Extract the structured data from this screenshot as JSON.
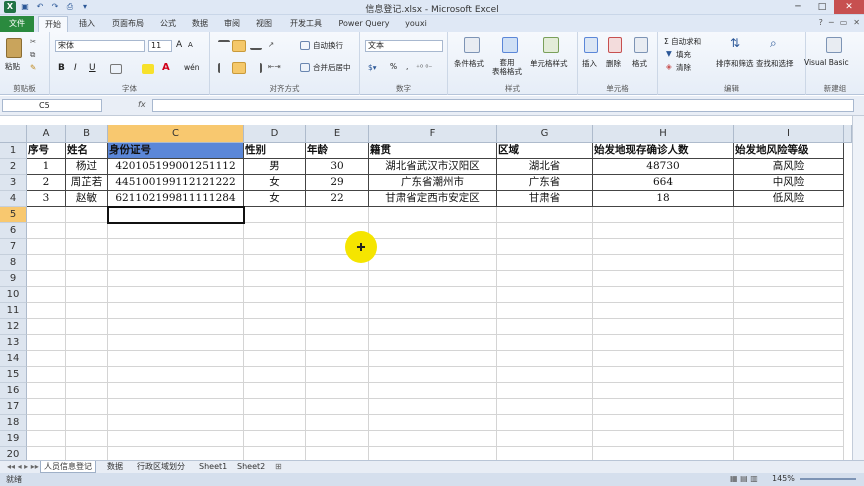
{
  "window": {
    "title": "信息登记.xlsx - Microsoft Excel",
    "controls": [
      "─",
      "□",
      "✕"
    ]
  },
  "ribbon_tabs": [
    "文件",
    "开始",
    "插入",
    "页面布局",
    "公式",
    "数据",
    "审阅",
    "视图",
    "开发工具",
    "Power Query",
    "youxi"
  ],
  "ribbon": {
    "clipboard": {
      "paste": "粘贴",
      "label": "剪贴板"
    },
    "font": {
      "name": "宋体",
      "size": "11",
      "bold": "B",
      "italic": "I",
      "underline": "U",
      "grow": "A",
      "shrink": "A",
      "color_a": "A",
      "wen": "wén",
      "label": "字体"
    },
    "alignment": {
      "wrap": "自动换行",
      "merge": "合并后居中",
      "label": "对齐方式"
    },
    "number": {
      "format": "文本",
      "percent": "%",
      "comma": ",",
      "label": "数字"
    },
    "styles": {
      "conditional": "条件格式",
      "table": "套用\n表格格式",
      "cell_styles": "单元格样式",
      "label": "样式"
    },
    "cells": {
      "insert": "插入",
      "delete": "删除",
      "format": "格式",
      "label": "单元格"
    },
    "editing": {
      "autosum": "Σ 自动求和",
      "fill": "填充",
      "clear": "清除",
      "sort": "排序和筛选",
      "find": "查找和选择",
      "label": "编辑"
    },
    "newgroup": {
      "vb": "Visual Basic",
      "label": "新建组"
    }
  },
  "formula_bar": {
    "name_box": "C5",
    "fx": "fx",
    "content": ""
  },
  "columns": [
    "A",
    "B",
    "C",
    "D",
    "E",
    "F",
    "G",
    "H",
    "I"
  ],
  "rows": [
    "1",
    "2",
    "3",
    "4",
    "5",
    "6",
    "7",
    "8",
    "9",
    "10",
    "11",
    "12",
    "13",
    "14",
    "15",
    "16",
    "17",
    "18",
    "19",
    "20"
  ],
  "table": {
    "headers": [
      "序号",
      "姓名",
      "身份证号",
      "性别",
      "年龄",
      "籍贯",
      "区域",
      "始发地现存确诊人数",
      "始发地风险等级"
    ],
    "rows": [
      [
        "1",
        "杨过",
        "420105199001251112",
        "男",
        "30",
        "湖北省武汉市汉阳区",
        "湖北省",
        "48730",
        "高风险"
      ],
      [
        "2",
        "周芷若",
        "445100199112121222",
        "女",
        "29",
        "广东省潮州市",
        "广东省",
        "664",
        "中风险"
      ],
      [
        "3",
        "赵敏",
        "621102199811111284",
        "女",
        "22",
        "甘肃省定西市安定区",
        "甘肃省",
        "18",
        "低风险"
      ]
    ]
  },
  "sheets": [
    "人员信息登记",
    "数据",
    "行政区域划分",
    "Sheet1",
    "Sheet2"
  ],
  "status": {
    "ready": "就绪",
    "zoom": "145%"
  },
  "colors": {
    "header_fill": "#5b87d8",
    "selected_header": "#f8c86f",
    "file_tab": "#2a8a3e",
    "cursor": "#f5e500"
  }
}
